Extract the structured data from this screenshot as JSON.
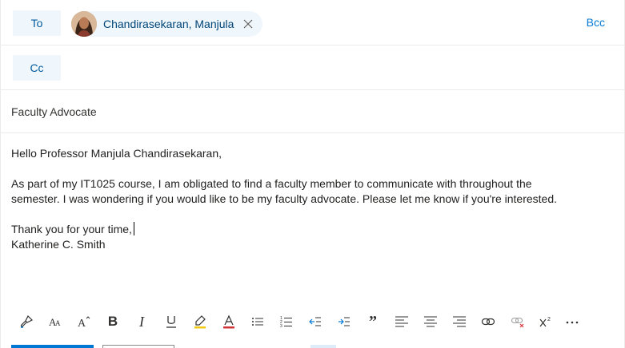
{
  "recipients": {
    "to_label": "To",
    "cc_label": "Cc",
    "bcc_label": "Bcc",
    "to": [
      {
        "name": "Chandirasekaran, Manjula"
      }
    ]
  },
  "subject": "Faculty Advocate",
  "body": {
    "greeting": "Hello Professor Manjula Chandirasekaran,",
    "paragraph_line1": "As part of my IT1025 course, I am obligated to find a faculty member to communicate with throughout the",
    "paragraph_line2": "semester. I was wondering if you would like to be my faculty advocate. Please let me know if you're interested.",
    "closing": "Thank you for your time,",
    "signature": "Katherine C. Smith"
  },
  "toolbar": {
    "buttons": [
      "format-painter",
      "font-size",
      "grow-font",
      "bold",
      "italic",
      "underline",
      "highlight",
      "font-color",
      "bullets",
      "numbering",
      "decrease-indent",
      "increase-indent",
      "quote",
      "align-left",
      "align-center",
      "align-right",
      "insert-link",
      "remove-link",
      "superscript",
      "more"
    ]
  },
  "colors": {
    "accent": "#0078d4",
    "chip_bg": "#eff6fc",
    "highlight": "#f2c811",
    "font_color_red": "#d13438"
  }
}
